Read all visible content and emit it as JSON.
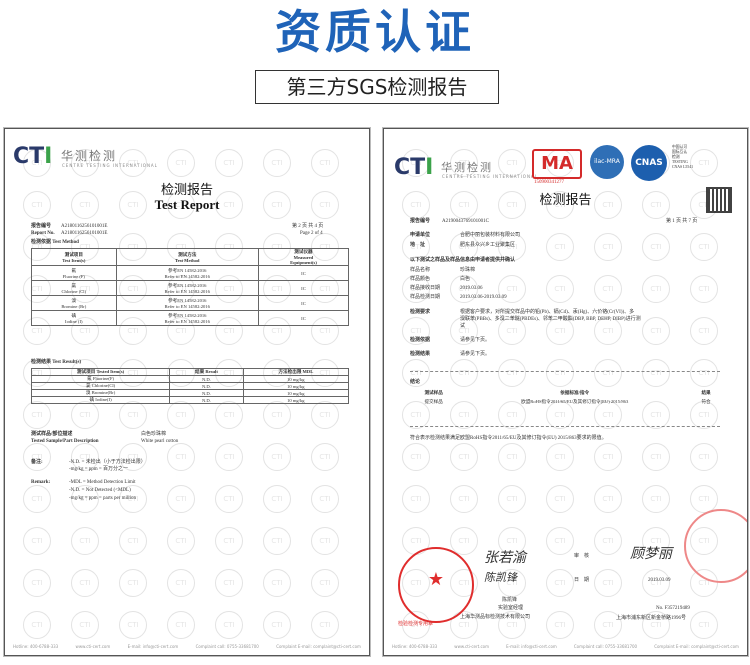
{
  "banner": {
    "title": "资质认证",
    "subtitle": "第三方SGS检测报告"
  },
  "left_report": {
    "logo_mark": "CTI",
    "logo_cn": "华测检测",
    "logo_en": "CENTRE TESTING INTERNATIONAL",
    "title_cn": "检测报告",
    "title_en": "Test Report",
    "report_no_label": "报告编号",
    "report_no_value": "A2180116256101001E",
    "report_no_label_en": "Report No.",
    "report_no_value2": "A2180116256101001E",
    "page_cn": "第 2 页  共 4 页",
    "page_en": "Page 2 of 4",
    "method_header": "检测依据 Test Method",
    "method_table": {
      "headers": [
        "测试项目\nTest Item(s)",
        "测试方法\nTest Method",
        "测试仪器\nMeasured\nEquipment(s)"
      ],
      "rows": [
        [
          "氟\nFluorine (F)",
          "参考EN 14582:2016\nRefer to EN 14582:2016",
          "IC"
        ],
        [
          "氯\nChlorine (Cl)",
          "参考EN 14582:2016\nRefer to EN 14582:2016",
          "IC"
        ],
        [
          "溴\nBromine (Br)",
          "参考EN 14582:2016\nRefer to EN 14582:2016",
          "IC"
        ],
        [
          "碘\nIodine (I)",
          "参考EN 14582:2016\nRefer to EN 14582:2016",
          "IC"
        ]
      ]
    },
    "result_header": "检测结果 Test Result(s)",
    "result_table": {
      "headers": [
        "测试项目 Tested Item(s)",
        "结果 Result",
        "方法检出限 MDL"
      ],
      "rows": [
        [
          "氟 Fluorine(F)",
          "N.D.",
          "10 mg/kg"
        ],
        [
          "氯 Chlorine(Cl)",
          "N.D.",
          "10 mg/kg"
        ],
        [
          "溴 Bromine(Br)",
          "N.D.",
          "10 mg/kg"
        ],
        [
          "碘 Iodine(I)",
          "N.D.",
          "10 mg/kg"
        ]
      ]
    },
    "sample_label_cn": "测试样品/部位描述",
    "sample_label_en": "Tested Sample/Part Description",
    "sample_value_cn": "白色珍珠棉",
    "sample_value_en": "White pearl cotton",
    "remark_cn_label": "备注:",
    "remark_cn_1": "-N.D. = 未检出（小于方法检出限）",
    "remark_cn_2": "-mg/kg = ppm = 百万分之一",
    "remark_en_label": "Remark:",
    "remark_en_1": "-MDL = Method Detection Limit",
    "remark_en_2": "-N.D. = Not Detected (<MDL)",
    "remark_en_3": "-mg/kg = ppm = parts per million",
    "footer": [
      "Hotline: 400-6788-333",
      "www.cti-cert.com",
      "E-mail: info@cti-cert.com",
      "Complaint call: 0755-33681700",
      "Complaint E-mail: complaint@cti-cert.com"
    ],
    "watermark": "CTI"
  },
  "right_report": {
    "logo_mark": "CTI",
    "logo_cn": "华测检测",
    "logo_en": "CENTRE TESTING INTERNATIONAL",
    "cma_text": "MA",
    "cma_no": "150900341277",
    "ilac_text": "ilac-MRA",
    "cnas_text": "CNAS",
    "cnas_side": "中国认可\n国际互认\n检测\nTESTING\nCNAS L5541",
    "title_cn": "检测报告",
    "report_no_label": "报告编号",
    "report_no_value": "A2190043769101001C",
    "page_cn": "第 1 页 共 7 页",
    "applicant_label": "申请单位",
    "applicant_value": "合肥中丽包装材料有限公司",
    "address_label": "地　址",
    "address_value": "肥东县众兴乡工业聚集区",
    "info_header": "以下测试之样品及样品信息由申请者提供并确认",
    "fields": [
      {
        "label": "样品名称",
        "value": "珍珠棉"
      },
      {
        "label": "样品颜色",
        "value": "白色"
      },
      {
        "label": "样品接收日期",
        "value": "2019.03.06"
      },
      {
        "label": "样品检测日期",
        "value": "2019.03.06-2019.03.09"
      }
    ],
    "req_label": "检测要求",
    "req_value_1": "根据客户要求，对所提交样品中的铅(Pb)、镉(Cd)、汞(Hg)、六价铬(Cr(VI))、多",
    "req_value_2": "溴联苯(PBBs)、多溴二苯醚(PBDEs)、邻苯二甲酸酯(DBP, BBP, DEHP, DIBP)进行测",
    "req_value_3": "试",
    "basis_label": "检测依据",
    "basis_value": "请参见下页。",
    "result_label": "检测结果",
    "result_value": "请参见下页。",
    "conclusion_label": "结论",
    "conc_table": {
      "headers": [
        "测试样品",
        "依据标准/指令",
        "结果"
      ],
      "rows": [
        [
          "提交样品",
          "欧盟RoHS指令2011/65/EU及其修订指令(EU) 2015/863",
          "符合"
        ]
      ]
    },
    "conc_note": "符合表示检测结果满足欧盟RoHS指令2011/65/EU及其修订指令(EU) 2015/863要求的限值。",
    "sig_compiler": "张若渝",
    "sig_reviewer_label": "审　核",
    "sig_reviewer": "顾梦丽",
    "sig_approver": "陈凯锋",
    "date_label": "日　期",
    "date_value": "2019.03.09",
    "approver_name": "陈凯锋",
    "approver_title": "实验室经理",
    "seal_text": "检验检测专用章",
    "seal_company": "上海华测品标检测技术有限公司",
    "cert_no": "No. F357219489",
    "company_addr": "上海市浦东新区新金桥路1996号",
    "footer": [
      "Hotline: 400-6788-333",
      "www.cti-cert.com",
      "E-mail: info@cti-cert.com",
      "Complaint call: 0755-33681700",
      "Complaint E-mail: complaint@cti-cert.com"
    ],
    "watermark": "CTI"
  }
}
